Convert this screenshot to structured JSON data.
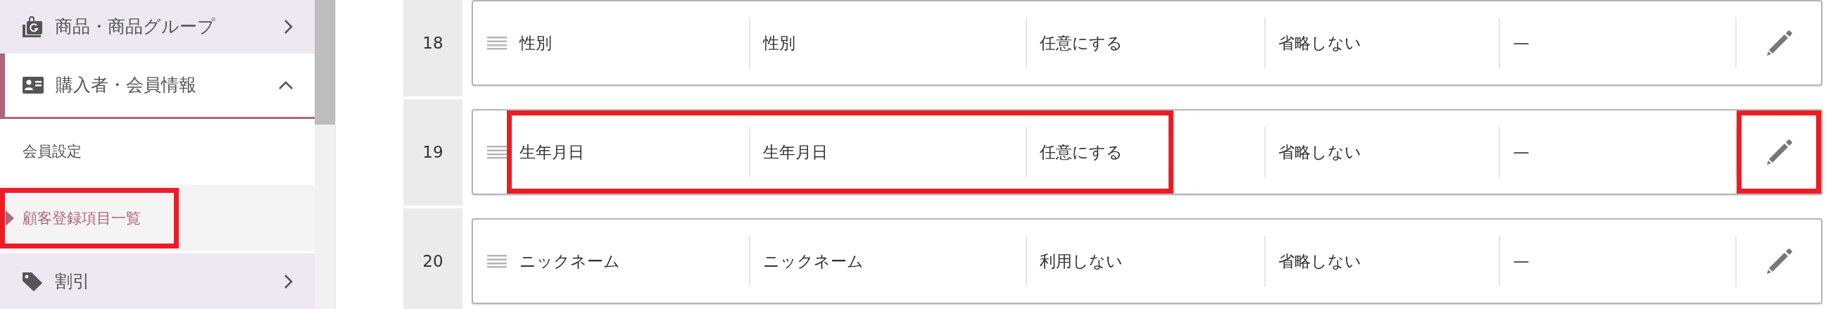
{
  "sidebar": {
    "items": [
      {
        "label": "商品・商品グループ",
        "expanded": false
      },
      {
        "label": "購入者・会員情報",
        "expanded": true,
        "children": [
          {
            "label": "会員設定",
            "selected": false,
            "highlighted": false
          },
          {
            "label": "顧客登録項目一覧",
            "selected": true,
            "highlighted": true
          }
        ]
      },
      {
        "label": "割引",
        "expanded": false
      }
    ]
  },
  "rows": [
    {
      "number": "18",
      "cells": [
        "性別",
        "性別",
        "任意にする",
        "省略しない",
        "—"
      ],
      "highlighted": false,
      "edit_highlighted": false
    },
    {
      "number": "19",
      "cells": [
        "生年月日",
        "生年月日",
        "任意にする",
        "省略しない",
        "—"
      ],
      "highlighted": true,
      "edit_highlighted": true
    },
    {
      "number": "20",
      "cells": [
        "ニックネーム",
        "ニックネーム",
        "利用しない",
        "省略しない",
        "—"
      ],
      "highlighted": false,
      "edit_highlighted": false
    }
  ]
}
